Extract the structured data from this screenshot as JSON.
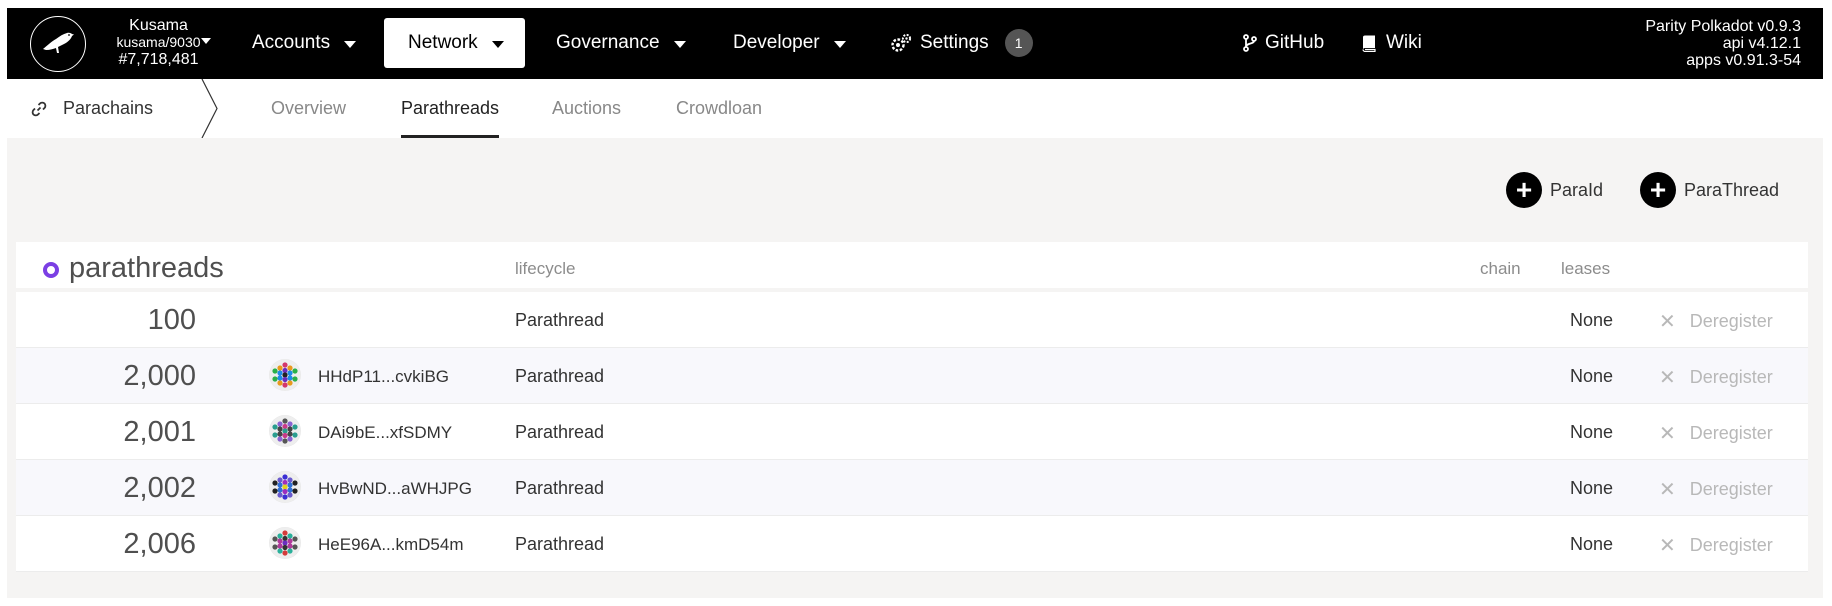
{
  "header": {
    "chain": {
      "name": "Kusama",
      "node": "kusama/9030",
      "block": "#7,718,481"
    },
    "nav": [
      {
        "label": "Accounts",
        "has_dropdown": true
      },
      {
        "label": "Network",
        "has_dropdown": true,
        "active": true
      },
      {
        "label": "Governance",
        "has_dropdown": true
      },
      {
        "label": "Developer",
        "has_dropdown": true
      },
      {
        "label": "Settings",
        "badge": "1",
        "icon": "gears-icon"
      }
    ],
    "links": [
      {
        "label": "GitHub",
        "icon": "git-branch-icon"
      },
      {
        "label": "Wiki",
        "icon": "book-icon"
      }
    ],
    "versions": [
      "Parity Polkadot v0.9.3",
      "api v4.12.1",
      "apps v0.91.3-54"
    ]
  },
  "subnav": {
    "section": {
      "label": "Parachains",
      "icon": "link-icon"
    },
    "tabs": [
      {
        "label": "Overview",
        "active": false
      },
      {
        "label": "Parathreads",
        "active": true
      },
      {
        "label": "Auctions",
        "active": false
      },
      {
        "label": "Crowdloan",
        "active": false
      }
    ]
  },
  "actions": [
    {
      "label": "ParaId",
      "icon": "plus-icon"
    },
    {
      "label": "ParaThread",
      "icon": "plus-icon"
    }
  ],
  "table": {
    "title": "parathreads",
    "columns": {
      "lifecycle": "lifecycle",
      "chain": "chain",
      "leases": "leases"
    },
    "rows": [
      {
        "id": "100",
        "address": "",
        "lifecycle": "Parathread",
        "leases": "None",
        "action": "Deregister"
      },
      {
        "id": "2,000",
        "address": "HHdP11...cvkiBG",
        "lifecycle": "Parathread",
        "leases": "None",
        "action": "Deregister"
      },
      {
        "id": "2,001",
        "address": "DAi9bE...xfSDMY",
        "lifecycle": "Parathread",
        "leases": "None",
        "action": "Deregister"
      },
      {
        "id": "2,002",
        "address": "HvBwND...aWHJPG",
        "lifecycle": "Parathread",
        "leases": "None",
        "action": "Deregister"
      },
      {
        "id": "2,006",
        "address": "HeE96A...kmD54m",
        "lifecycle": "Parathread",
        "leases": "None",
        "action": "Deregister"
      }
    ]
  },
  "colors": {
    "accent": "#7b3fe4",
    "topbar": "#000000",
    "background": "#f5f4f3"
  }
}
